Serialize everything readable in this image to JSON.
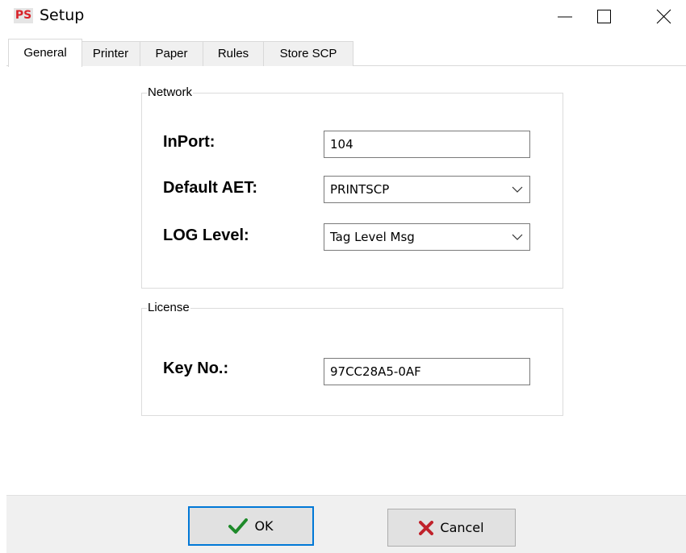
{
  "window": {
    "icon_text": "PS",
    "title": "Setup"
  },
  "tabs": [
    {
      "label": "General",
      "active": true
    },
    {
      "label": "Printer",
      "active": false
    },
    {
      "label": "Paper",
      "active": false
    },
    {
      "label": "Rules",
      "active": false
    },
    {
      "label": "Store SCP",
      "active": false
    }
  ],
  "network": {
    "legend": "Network",
    "inport_label": "InPort:",
    "inport_value": "104",
    "aet_label": "Default AET:",
    "aet_value": "PRINTSCP",
    "log_label": "LOG Level:",
    "log_value": "Tag Level Msg"
  },
  "license": {
    "legend": "License",
    "key_label": "Key No.:",
    "key_value": "97CC28A5-0AF"
  },
  "buttons": {
    "ok": "OK",
    "cancel": "Cancel"
  },
  "colors": {
    "accent": "#0078d7",
    "ok_check": "#1e8a2a",
    "cancel_x": "#c0222b"
  }
}
